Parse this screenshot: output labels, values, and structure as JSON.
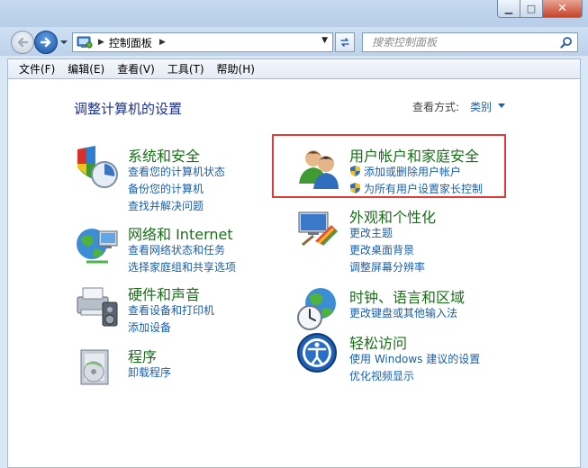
{
  "window": {
    "minimize_glyph": "▁",
    "maximize_glyph": "□",
    "close_glyph": "✕"
  },
  "navbar": {
    "address_crumb": "控制面板",
    "search_placeholder": "搜索控制面板"
  },
  "menu": [
    "文件(F)",
    "编辑(E)",
    "查看(V)",
    "工具(T)",
    "帮助(H)"
  ],
  "content": {
    "title": "调整计算机的设置",
    "view_by_label": "查看方式:",
    "view_by_value": "类别"
  },
  "categories": [
    {
      "title": "系统和安全",
      "icon": "system-security-icon",
      "links": [
        "查看您的计算机状态",
        "备份您的计算机",
        "查找并解决问题"
      ]
    },
    {
      "title": "网络和 Internet",
      "icon": "network-icon",
      "links": [
        "查看网络状态和任务",
        "选择家庭组和共享选项"
      ]
    },
    {
      "title": "硬件和声音",
      "icon": "hardware-sound-icon",
      "links": [
        "查看设备和打印机",
        "添加设备"
      ]
    },
    {
      "title": "程序",
      "icon": "programs-icon",
      "links": [
        "卸载程序"
      ]
    },
    {
      "title": "用户帐户和家庭安全",
      "icon": "user-accounts-icon",
      "links": [
        "添加或删除用户帐户",
        "为所有用户设置家长控制"
      ]
    },
    {
      "title": "外观和个性化",
      "icon": "appearance-icon",
      "links": [
        "更改主题",
        "更改桌面背景",
        "调整屏幕分辨率"
      ]
    },
    {
      "title": "时钟、语言和区域",
      "icon": "clock-language-icon",
      "links": [
        "更改键盘或其他输入法"
      ]
    },
    {
      "title": "轻松访问",
      "icon": "ease-of-access-icon",
      "links": [
        "使用 Windows 建议的设置",
        "优化视频显示"
      ]
    }
  ],
  "colors": {
    "category_title": "#1a6e1a",
    "link": "#1a5fa8",
    "page_title": "#1e3287",
    "highlight": "#e03a3a"
  }
}
